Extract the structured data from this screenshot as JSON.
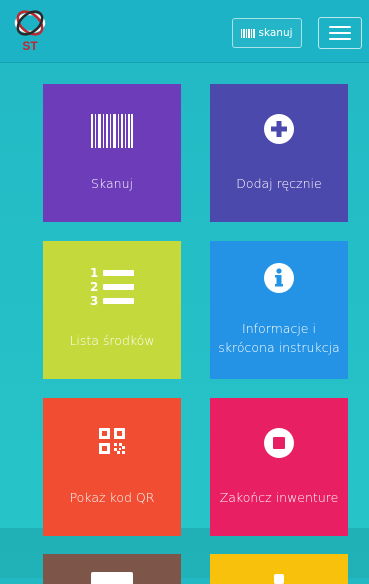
{
  "header": {
    "logo_text": "ST",
    "scan_button_label": "skanuj"
  },
  "tiles": [
    {
      "label": "Skanuj",
      "color": "#6d3db9",
      "icon": "barcode-icon"
    },
    {
      "label": "Dodaj ręcznie",
      "color": "#4c49ac",
      "icon": "plus-circle-icon"
    },
    {
      "label": "Lista środków",
      "color": "#c3d93c",
      "icon": "numbered-list-icon"
    },
    {
      "label": "Informacje i skrócona instrukcja",
      "color": "#2493e6",
      "icon": "info-circle-icon"
    },
    {
      "label": "Pokaż kod QR",
      "color": "#f04d33",
      "icon": "qr-code-icon"
    },
    {
      "label": "Zakończ inwenture",
      "color": "#e91f63",
      "icon": "stop-circle-icon"
    }
  ],
  "colors": {
    "background": "#22b8c4",
    "header": "#1cb3c6"
  }
}
